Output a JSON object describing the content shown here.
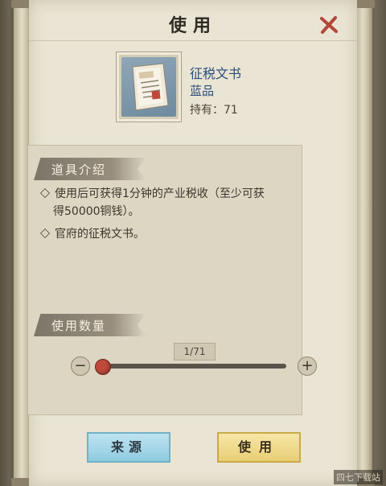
{
  "dialog": {
    "title": "使用"
  },
  "item": {
    "name": "征税文书",
    "quality": "蓝品",
    "owned_label": "持有",
    "owned_count": "71",
    "owned_text": "持有：71"
  },
  "description": {
    "header": "道具介绍",
    "line1a": "使用后可获得1分钟的产业税收（至少可获",
    "line1b": "得50000铜钱）。",
    "line2": "官府的征税文书。"
  },
  "quantity": {
    "header": "使用数量",
    "readout": "1/71",
    "current": 1,
    "max": 71,
    "minus_label": "−",
    "plus_label": "+"
  },
  "buttons": {
    "source": "来源",
    "use": "使用"
  },
  "watermark": "四七下载站",
  "colors": {
    "item_name": "#2b4d7a",
    "slider_thumb": "#c0493a",
    "source_button": "#8fcbe0",
    "use_button": "#e9cf73"
  }
}
